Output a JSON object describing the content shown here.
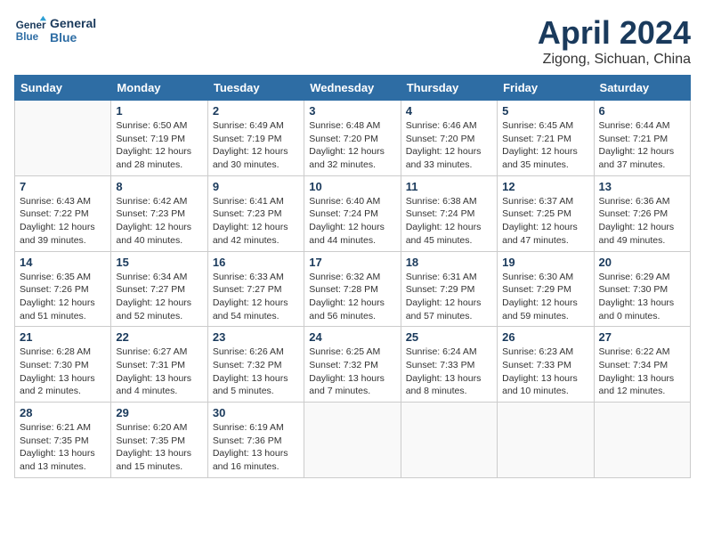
{
  "header": {
    "logo_line1": "General",
    "logo_line2": "Blue",
    "month_title": "April 2024",
    "subtitle": "Zigong, Sichuan, China"
  },
  "days_of_week": [
    "Sunday",
    "Monday",
    "Tuesday",
    "Wednesday",
    "Thursday",
    "Friday",
    "Saturday"
  ],
  "weeks": [
    [
      {
        "num": "",
        "sunrise": "",
        "sunset": "",
        "daylight": ""
      },
      {
        "num": "1",
        "sunrise": "Sunrise: 6:50 AM",
        "sunset": "Sunset: 7:19 PM",
        "daylight": "Daylight: 12 hours and 28 minutes."
      },
      {
        "num": "2",
        "sunrise": "Sunrise: 6:49 AM",
        "sunset": "Sunset: 7:19 PM",
        "daylight": "Daylight: 12 hours and 30 minutes."
      },
      {
        "num": "3",
        "sunrise": "Sunrise: 6:48 AM",
        "sunset": "Sunset: 7:20 PM",
        "daylight": "Daylight: 12 hours and 32 minutes."
      },
      {
        "num": "4",
        "sunrise": "Sunrise: 6:46 AM",
        "sunset": "Sunset: 7:20 PM",
        "daylight": "Daylight: 12 hours and 33 minutes."
      },
      {
        "num": "5",
        "sunrise": "Sunrise: 6:45 AM",
        "sunset": "Sunset: 7:21 PM",
        "daylight": "Daylight: 12 hours and 35 minutes."
      },
      {
        "num": "6",
        "sunrise": "Sunrise: 6:44 AM",
        "sunset": "Sunset: 7:21 PM",
        "daylight": "Daylight: 12 hours and 37 minutes."
      }
    ],
    [
      {
        "num": "7",
        "sunrise": "Sunrise: 6:43 AM",
        "sunset": "Sunset: 7:22 PM",
        "daylight": "Daylight: 12 hours and 39 minutes."
      },
      {
        "num": "8",
        "sunrise": "Sunrise: 6:42 AM",
        "sunset": "Sunset: 7:23 PM",
        "daylight": "Daylight: 12 hours and 40 minutes."
      },
      {
        "num": "9",
        "sunrise": "Sunrise: 6:41 AM",
        "sunset": "Sunset: 7:23 PM",
        "daylight": "Daylight: 12 hours and 42 minutes."
      },
      {
        "num": "10",
        "sunrise": "Sunrise: 6:40 AM",
        "sunset": "Sunset: 7:24 PM",
        "daylight": "Daylight: 12 hours and 44 minutes."
      },
      {
        "num": "11",
        "sunrise": "Sunrise: 6:38 AM",
        "sunset": "Sunset: 7:24 PM",
        "daylight": "Daylight: 12 hours and 45 minutes."
      },
      {
        "num": "12",
        "sunrise": "Sunrise: 6:37 AM",
        "sunset": "Sunset: 7:25 PM",
        "daylight": "Daylight: 12 hours and 47 minutes."
      },
      {
        "num": "13",
        "sunrise": "Sunrise: 6:36 AM",
        "sunset": "Sunset: 7:26 PM",
        "daylight": "Daylight: 12 hours and 49 minutes."
      }
    ],
    [
      {
        "num": "14",
        "sunrise": "Sunrise: 6:35 AM",
        "sunset": "Sunset: 7:26 PM",
        "daylight": "Daylight: 12 hours and 51 minutes."
      },
      {
        "num": "15",
        "sunrise": "Sunrise: 6:34 AM",
        "sunset": "Sunset: 7:27 PM",
        "daylight": "Daylight: 12 hours and 52 minutes."
      },
      {
        "num": "16",
        "sunrise": "Sunrise: 6:33 AM",
        "sunset": "Sunset: 7:27 PM",
        "daylight": "Daylight: 12 hours and 54 minutes."
      },
      {
        "num": "17",
        "sunrise": "Sunrise: 6:32 AM",
        "sunset": "Sunset: 7:28 PM",
        "daylight": "Daylight: 12 hours and 56 minutes."
      },
      {
        "num": "18",
        "sunrise": "Sunrise: 6:31 AM",
        "sunset": "Sunset: 7:29 PM",
        "daylight": "Daylight: 12 hours and 57 minutes."
      },
      {
        "num": "19",
        "sunrise": "Sunrise: 6:30 AM",
        "sunset": "Sunset: 7:29 PM",
        "daylight": "Daylight: 12 hours and 59 minutes."
      },
      {
        "num": "20",
        "sunrise": "Sunrise: 6:29 AM",
        "sunset": "Sunset: 7:30 PM",
        "daylight": "Daylight: 13 hours and 0 minutes."
      }
    ],
    [
      {
        "num": "21",
        "sunrise": "Sunrise: 6:28 AM",
        "sunset": "Sunset: 7:30 PM",
        "daylight": "Daylight: 13 hours and 2 minutes."
      },
      {
        "num": "22",
        "sunrise": "Sunrise: 6:27 AM",
        "sunset": "Sunset: 7:31 PM",
        "daylight": "Daylight: 13 hours and 4 minutes."
      },
      {
        "num": "23",
        "sunrise": "Sunrise: 6:26 AM",
        "sunset": "Sunset: 7:32 PM",
        "daylight": "Daylight: 13 hours and 5 minutes."
      },
      {
        "num": "24",
        "sunrise": "Sunrise: 6:25 AM",
        "sunset": "Sunset: 7:32 PM",
        "daylight": "Daylight: 13 hours and 7 minutes."
      },
      {
        "num": "25",
        "sunrise": "Sunrise: 6:24 AM",
        "sunset": "Sunset: 7:33 PM",
        "daylight": "Daylight: 13 hours and 8 minutes."
      },
      {
        "num": "26",
        "sunrise": "Sunrise: 6:23 AM",
        "sunset": "Sunset: 7:33 PM",
        "daylight": "Daylight: 13 hours and 10 minutes."
      },
      {
        "num": "27",
        "sunrise": "Sunrise: 6:22 AM",
        "sunset": "Sunset: 7:34 PM",
        "daylight": "Daylight: 13 hours and 12 minutes."
      }
    ],
    [
      {
        "num": "28",
        "sunrise": "Sunrise: 6:21 AM",
        "sunset": "Sunset: 7:35 PM",
        "daylight": "Daylight: 13 hours and 13 minutes."
      },
      {
        "num": "29",
        "sunrise": "Sunrise: 6:20 AM",
        "sunset": "Sunset: 7:35 PM",
        "daylight": "Daylight: 13 hours and 15 minutes."
      },
      {
        "num": "30",
        "sunrise": "Sunrise: 6:19 AM",
        "sunset": "Sunset: 7:36 PM",
        "daylight": "Daylight: 13 hours and 16 minutes."
      },
      {
        "num": "",
        "sunrise": "",
        "sunset": "",
        "daylight": ""
      },
      {
        "num": "",
        "sunrise": "",
        "sunset": "",
        "daylight": ""
      },
      {
        "num": "",
        "sunrise": "",
        "sunset": "",
        "daylight": ""
      },
      {
        "num": "",
        "sunrise": "",
        "sunset": "",
        "daylight": ""
      }
    ]
  ]
}
